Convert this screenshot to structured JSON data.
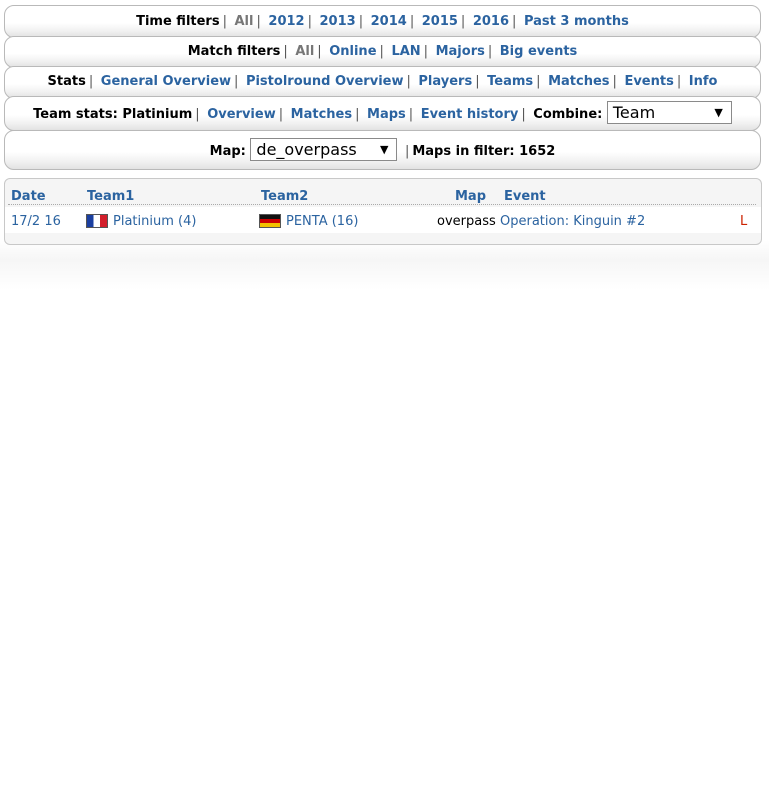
{
  "time_filters": {
    "label": "Time filters",
    "items": [
      "All",
      "2012",
      "2013",
      "2014",
      "2015",
      "2016",
      "Past 3 months"
    ]
  },
  "match_filters": {
    "label": "Match filters",
    "items": [
      "All",
      "Online",
      "LAN",
      "Majors",
      "Big events"
    ]
  },
  "stats_nav": {
    "label": "Stats",
    "items": [
      "General Overview",
      "Pistolround Overview",
      "Players",
      "Teams",
      "Matches",
      "Events",
      "Info"
    ]
  },
  "team_stats": {
    "label": "Team stats: Platinium",
    "items": [
      "Overview",
      "Matches",
      "Maps",
      "Event history"
    ],
    "combine_label": "Combine:",
    "combine_value": "Team"
  },
  "map_filter": {
    "label": "Map:",
    "value": "de_overpass",
    "maps_in_filter": "Maps in filter: 1652"
  },
  "results": {
    "columns": [
      "Date",
      "Team1",
      "Team2",
      "Map",
      "Event"
    ],
    "rows": [
      {
        "date": "17/2 16",
        "team1": "Platinium (4)",
        "team1_flag": "france-flag",
        "team2": "PENTA (16)",
        "team2_flag": "germany-flag",
        "map": "overpass",
        "event": "Operation: Kinguin #2",
        "result": "L"
      }
    ]
  },
  "colors": {
    "link": "#2b63a0",
    "loss": "#cc2200"
  }
}
